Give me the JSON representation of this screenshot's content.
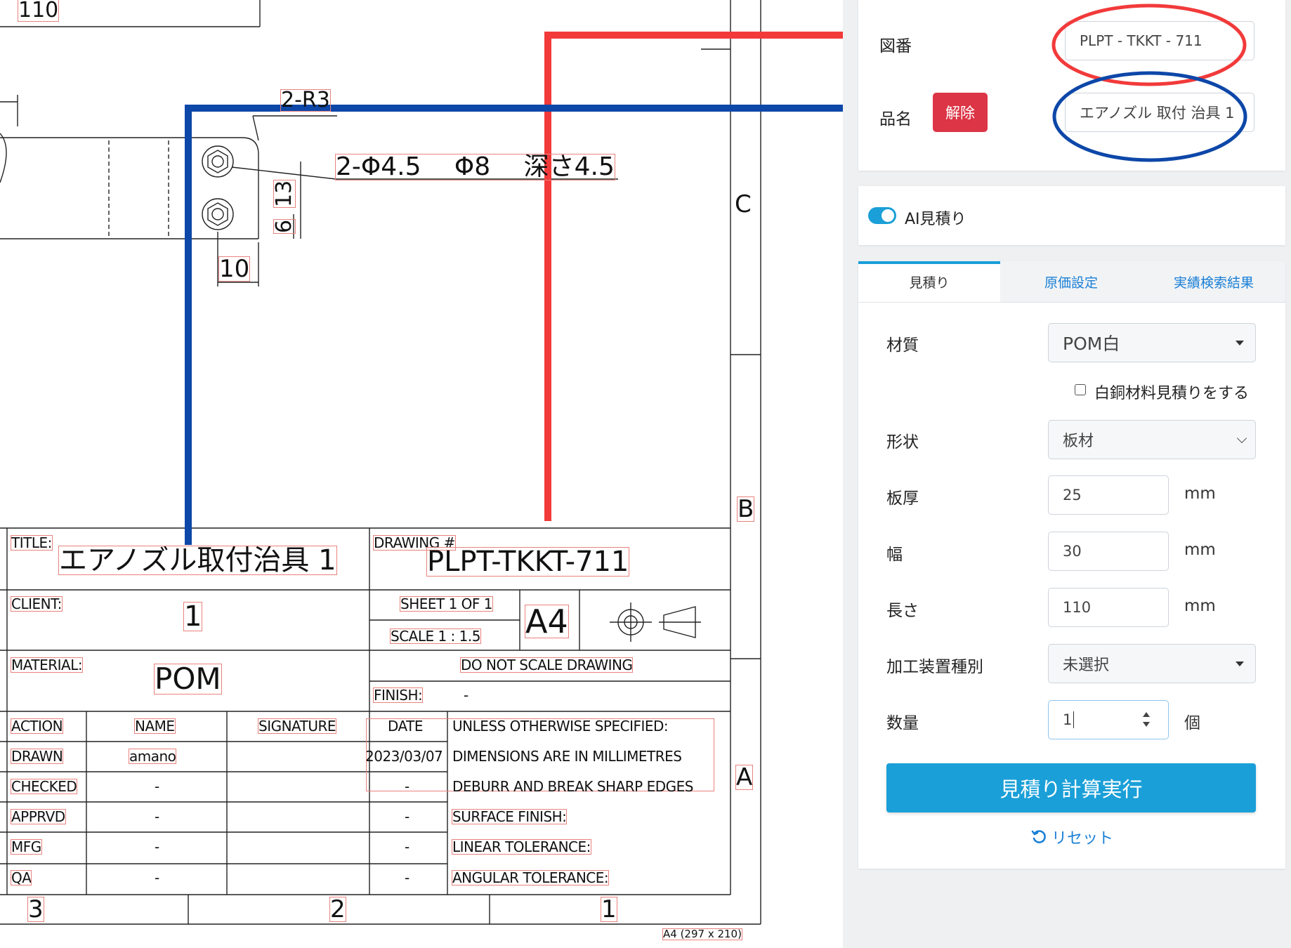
{
  "drawing": {
    "dims": {
      "top_dim": "110",
      "radius": "2-R3",
      "hole_spec": "2-Φ4.5 　Φ8 　深さ4.5",
      "vert_dim_a": "13",
      "vert_dim_b": "6",
      "horiz_dim": "10"
    },
    "zone_letters": {
      "c": "C",
      "b": "B",
      "a": "A"
    },
    "title_block": {
      "title_label": "TITLE:",
      "title": "エアノズル取付治具 1",
      "drawing_label": "DRAWING #",
      "drawing_no": "PLPT-TKKT-711",
      "client_label": "CLIENT:",
      "client": "1",
      "sheet": "SHEET 1 OF 1",
      "scale": "SCALE   1 : 1.5",
      "paper_size": "A4",
      "material_label": "MATERIAL:",
      "material": "POM",
      "note_scale": "DO NOT SCALE DRAWING",
      "finish_label": "FINISH:",
      "finish": "-",
      "headers": [
        "ACTION",
        "NAME",
        "SIGNATURE",
        "DATE"
      ],
      "rows": [
        {
          "action": "DRAWN",
          "name": "amano",
          "date": "2023/03/07"
        },
        {
          "action": "CHECKED",
          "name": "-",
          "date": "-"
        },
        {
          "action": "APPRVD",
          "name": "-",
          "date": "-"
        },
        {
          "action": "MFG",
          "name": "-",
          "date": "-"
        },
        {
          "action": "QA",
          "name": "-",
          "date": "-"
        }
      ],
      "notes": [
        "UNLESS OTHERWISE SPECIFIED:",
        "DIMENSIONS ARE IN MILLIMETRES",
        "DEBURR AND BREAK SHARP EDGES",
        "SURFACE FINISH:",
        "LINEAR TOLERANCE:",
        "ANGULAR TOLERANCE:"
      ],
      "bottom_numbers": [
        "3",
        "2",
        "1"
      ],
      "sheet_format": "A4  (297 x 210)"
    }
  },
  "panel": {
    "top": {
      "drawing_no_label": "図番",
      "drawing_no_value": "PLPT - TKKT - 711",
      "part_name_label": "品名",
      "remove_button": "解除",
      "part_name_value": "エアノズル 取付 治具 1"
    },
    "ai": {
      "label": "AI見積り",
      "enabled": true
    },
    "tabs": [
      "見積り",
      "原価設定",
      "実績検索結果"
    ],
    "form": {
      "material_label": "材質",
      "material_value": "POM白",
      "bronze_checkbox": "白銅材料見積りをする",
      "shape_label": "形状",
      "shape_value": "板材",
      "thickness_label": "板厚",
      "thickness_value": "25",
      "width_label": "幅",
      "width_value": "30",
      "length_label": "長さ",
      "length_value": "110",
      "unit_mm": "mm",
      "machine_label": "加工装置種別",
      "machine_value": "未選択",
      "qty_label": "数量",
      "qty_value": "1",
      "qty_unit": "個",
      "run_button": "見積り計算実行",
      "reset_link": "リセット"
    },
    "colors": {
      "accent": "#1a9fd8",
      "tab_link": "#1a7fd6",
      "danger": "#dc3545",
      "annotation_red": "#f23a3a",
      "annotation_blue": "#0d47a8"
    }
  }
}
